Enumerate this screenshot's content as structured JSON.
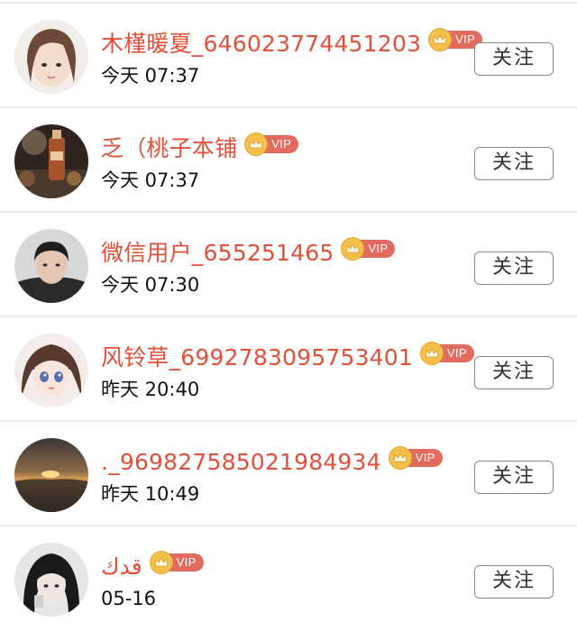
{
  "follow_list": [
    {
      "username": "木槿暖夏_646023774451203",
      "badge": "VIP",
      "time": "今天 07:37",
      "button_label": "关注",
      "avatar_icon": "avatar-girl-photo"
    },
    {
      "username": "乏（桃子本铺",
      "badge": "VIP",
      "time": "今天 07:37",
      "button_label": "关注",
      "avatar_icon": "avatar-product-bottle"
    },
    {
      "username": "微信用户_655251465",
      "badge": "VIP",
      "time": "今天 07:30",
      "button_label": "关注",
      "avatar_icon": "avatar-man-photo"
    },
    {
      "username": "风铃草_6992783095753401",
      "badge": "VIP",
      "time": "昨天 20:40",
      "button_label": "关注",
      "avatar_icon": "avatar-anime-doll"
    },
    {
      "username": "._969827585021984934",
      "badge": "VIP",
      "time": "昨天 10:49",
      "button_label": "关注",
      "avatar_icon": "avatar-sunset"
    },
    {
      "username": "قدك",
      "badge": "VIP",
      "time": "05-16",
      "button_label": "关注",
      "avatar_icon": "avatar-girl-bw"
    }
  ],
  "colors": {
    "username": "#e2503a",
    "vip_pill": "#e06b5e",
    "crown": "#f3c04b",
    "button_border": "#8a8a8a",
    "divider": "#ececec"
  }
}
